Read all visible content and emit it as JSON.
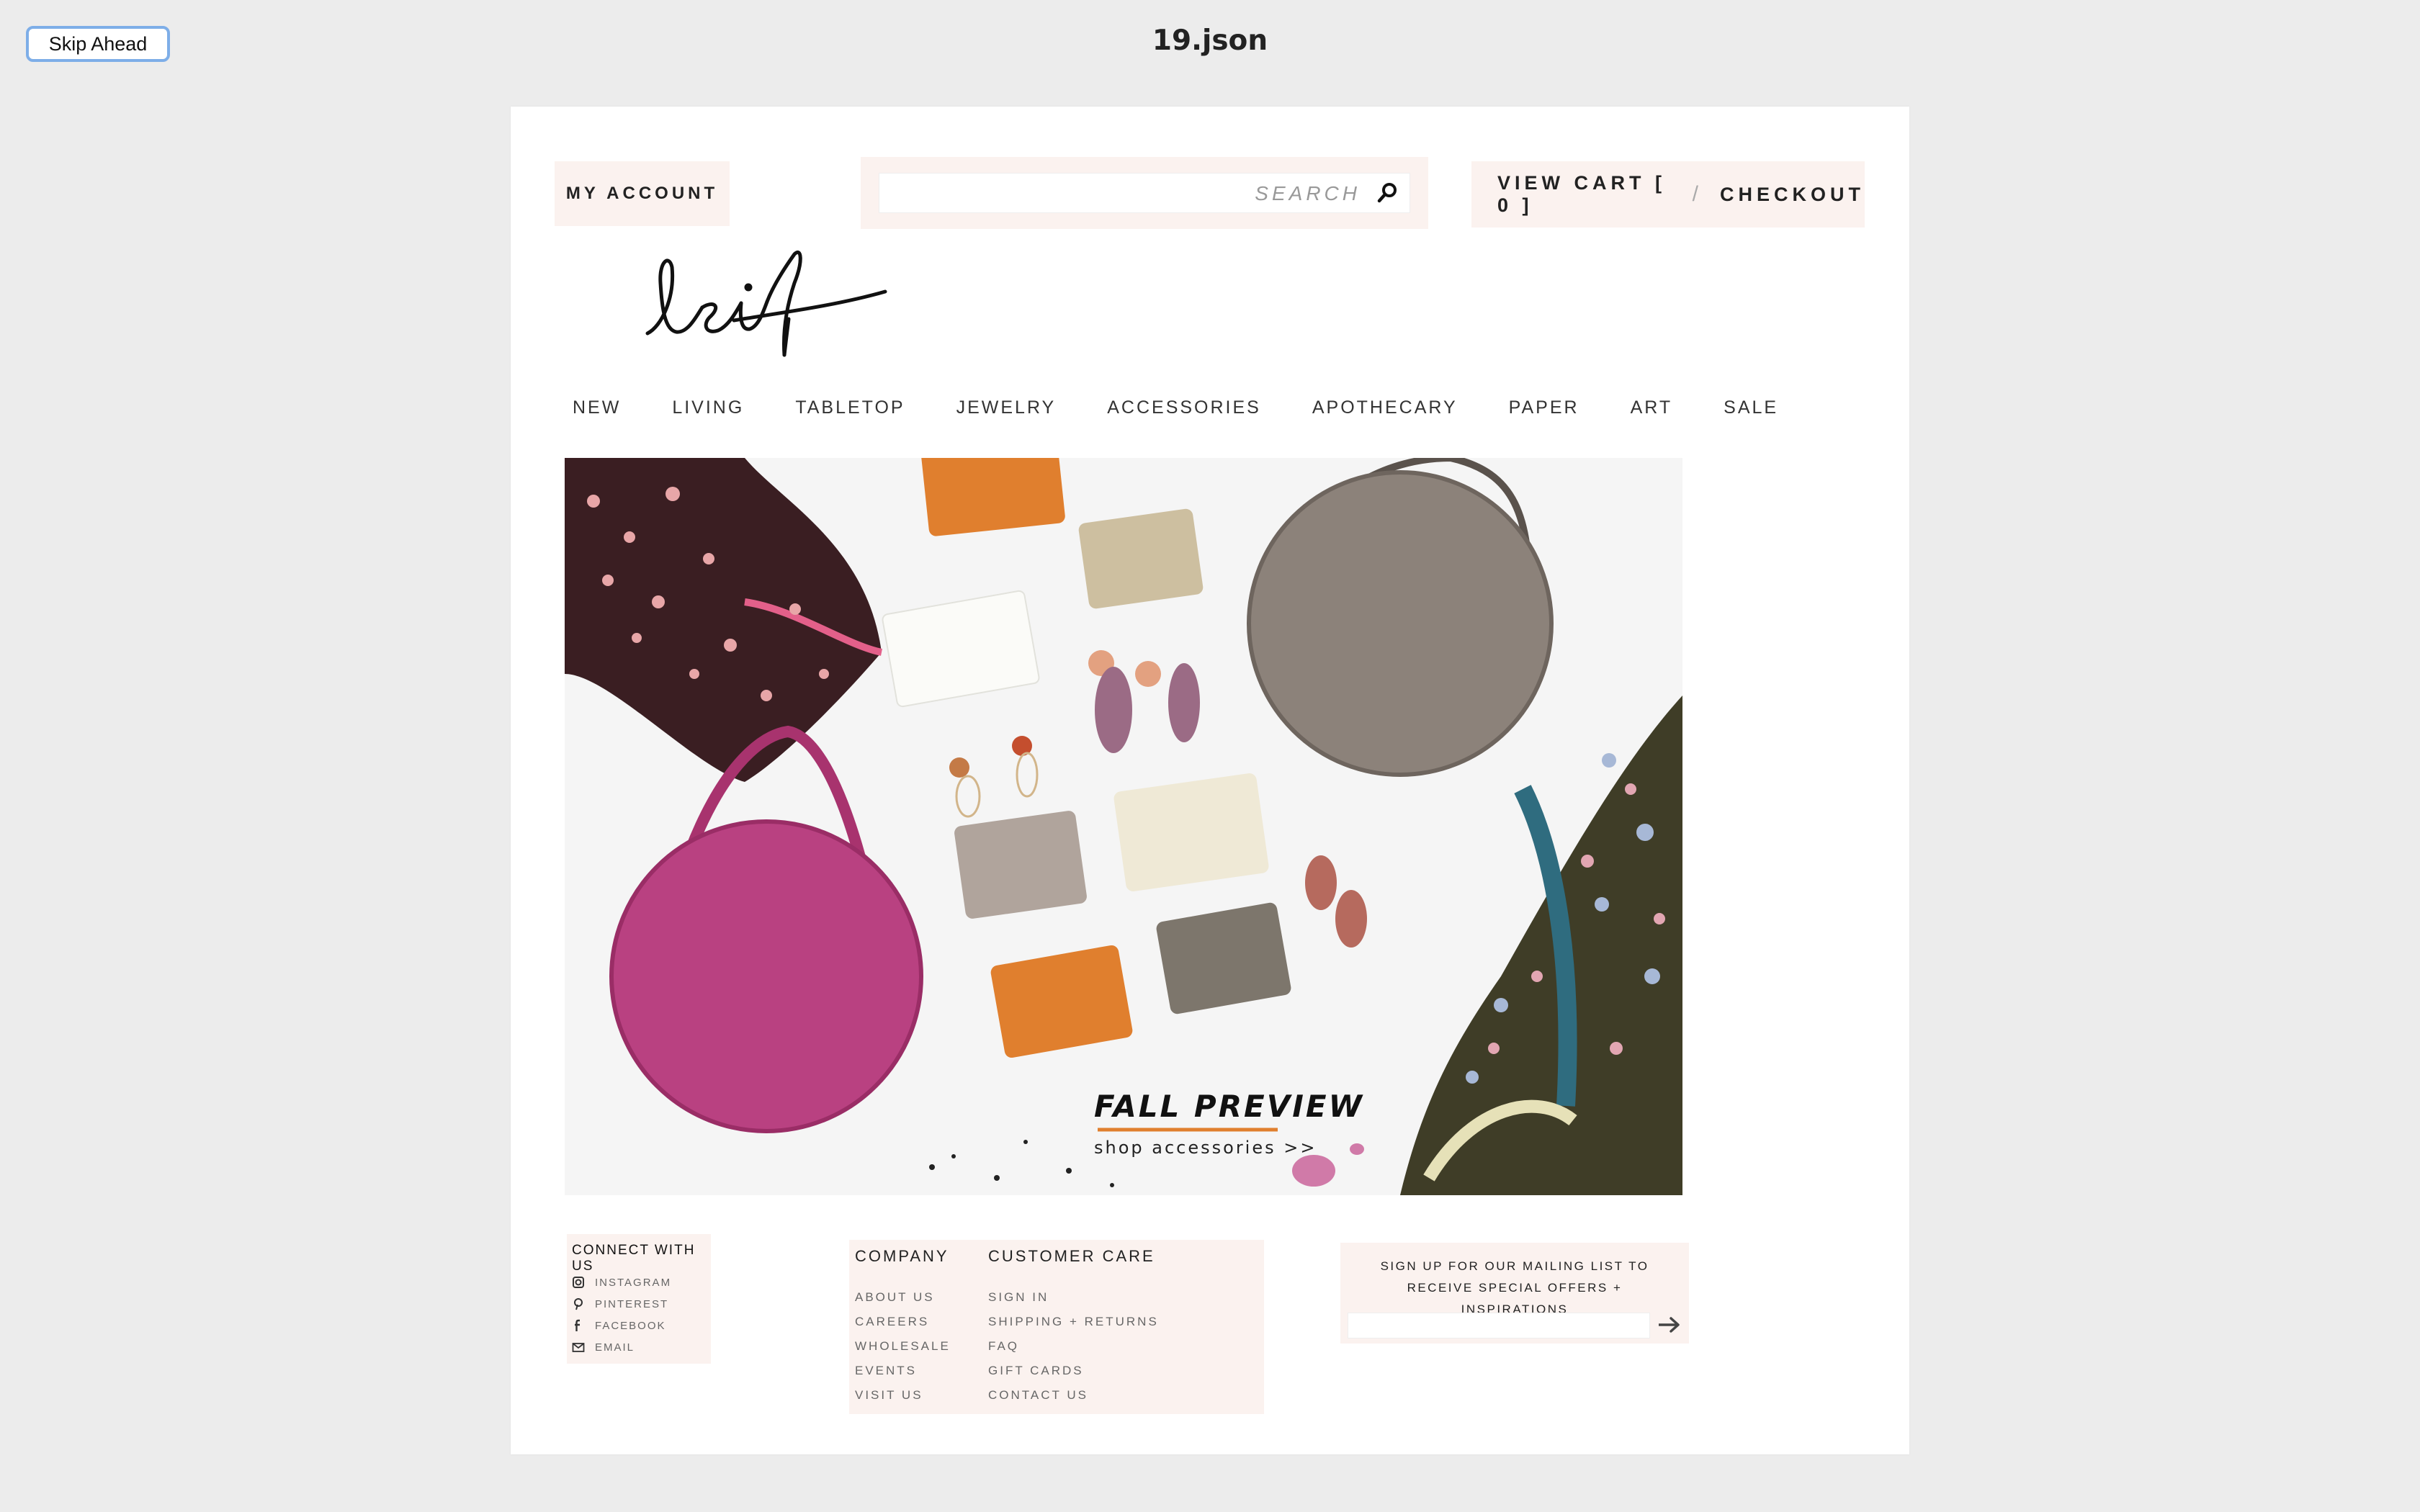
{
  "toolbar": {
    "skip_label": "Skip Ahead",
    "doc_title": "19.json"
  },
  "header": {
    "account_label": "MY ACCOUNT",
    "search_label": "SEARCH",
    "search_placeholder": "",
    "cart_label": "VIEW CART [ 0 ]",
    "cart_separator": "/",
    "checkout_label": "CHECKOUT",
    "logo_text": "leif"
  },
  "nav": {
    "items": [
      "NEW",
      "LIVING",
      "TABLETOP",
      "JEWELRY",
      "ACCESSORIES",
      "APOTHECARY",
      "PAPER",
      "ART",
      "SALE"
    ]
  },
  "hero": {
    "title": "FALL PREVIEW",
    "subtitle": "shop accessories >>"
  },
  "footer": {
    "connect": {
      "heading": "CONNECT WITH US",
      "links": [
        {
          "label": "INSTAGRAM",
          "icon": "instagram-icon"
        },
        {
          "label": "PINTEREST",
          "icon": "pinterest-icon"
        },
        {
          "label": "FACEBOOK",
          "icon": "facebook-icon"
        },
        {
          "label": "EMAIL",
          "icon": "email-icon"
        }
      ]
    },
    "company": {
      "heading": "COMPANY",
      "links": [
        "ABOUT US",
        "CAREERS",
        "WHOLESALE",
        "EVENTS",
        "VISIT US"
      ]
    },
    "care": {
      "heading": "CUSTOMER CARE",
      "links": [
        "SIGN IN",
        "SHIPPING + RETURNS",
        "FAQ",
        "GIFT CARDS",
        "CONTACT US"
      ]
    },
    "mailing": {
      "text": "SIGN UP FOR OUR MAILING LIST TO RECEIVE SPECIAL OFFERS + INSPIRATIONS",
      "input_value": ""
    }
  },
  "colors": {
    "panel_bg": "#fbf2ef",
    "page_bg": "#ececec",
    "skip_border": "#7eaee8"
  }
}
